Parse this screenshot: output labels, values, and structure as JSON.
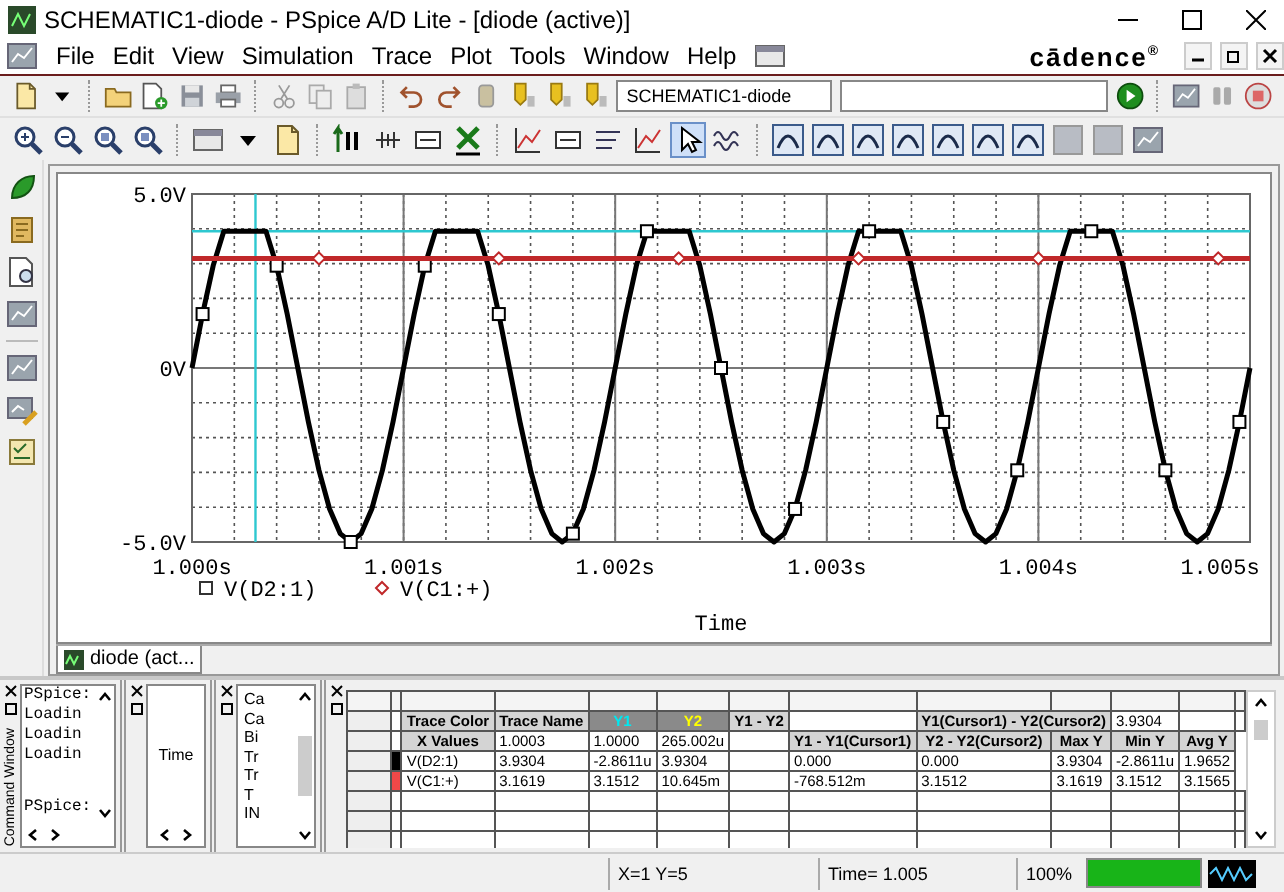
{
  "window": {
    "title": "SCHEMATIC1-diode - PSpice A/D Lite - [diode (active)]"
  },
  "menu": [
    "File",
    "Edit",
    "View",
    "Simulation",
    "Trace",
    "Plot",
    "Tools",
    "Window",
    "Help"
  ],
  "logo": "cādence$^{®}$",
  "toolbar": {
    "profile": "SCHEMATIC1-diode",
    "pointer_tool": {
      "selected": true
    }
  },
  "plot": {
    "tab": "diode (act...",
    "chart_data": {
      "type": "line",
      "xlabel": "Time",
      "xlim": [
        1.0,
        1.005
      ],
      "ylim": [
        -5,
        5
      ],
      "xticks": [
        {
          "value": 1.0,
          "label": "1.000s"
        },
        {
          "value": 1.001,
          "label": "1.001s"
        },
        {
          "value": 1.002,
          "label": "1.002s"
        },
        {
          "value": 1.003,
          "label": "1.003s"
        },
        {
          "value": 1.004,
          "label": "1.004s"
        },
        {
          "value": 1.005,
          "label": "1.005s"
        }
      ],
      "yticks": [
        {
          "value": 5,
          "label": "5.0V"
        },
        {
          "value": 0,
          "label": "0V"
        },
        {
          "value": -5,
          "label": "-5.0V"
        }
      ],
      "x": [
        1.0,
        1.00005,
        1.0001,
        1.00015,
        1.0002,
        1.00025,
        1.0003,
        1.00035,
        1.0004,
        1.00045,
        1.0005,
        1.00055,
        1.0006,
        1.00065,
        1.0007,
        1.00075,
        1.0008,
        1.00085,
        1.0009,
        1.00095,
        1.001,
        1.00105,
        1.0011,
        1.00115,
        1.0012,
        1.00125,
        1.0013,
        1.00135,
        1.0014,
        1.00145,
        1.0015,
        1.00155,
        1.0016,
        1.00165,
        1.0017,
        1.00175,
        1.0018,
        1.00185,
        1.0019,
        1.00195,
        1.002,
        1.00205,
        1.0021,
        1.00215,
        1.0022,
        1.00225,
        1.0023,
        1.00235,
        1.0024,
        1.00245,
        1.0025,
        1.00255,
        1.0026,
        1.00265,
        1.0027,
        1.00275,
        1.0028,
        1.00285,
        1.0029,
        1.00295,
        1.003,
        1.00305,
        1.0031,
        1.00315,
        1.0032,
        1.00325,
        1.0033,
        1.00335,
        1.0034,
        1.00345,
        1.0035,
        1.00355,
        1.0036,
        1.00365,
        1.0037,
        1.00375,
        1.0038,
        1.00385,
        1.0039,
        1.00395,
        1.004,
        1.00405,
        1.0041,
        1.00415,
        1.0042,
        1.00425,
        1.0043,
        1.00435,
        1.0044,
        1.00445,
        1.0045,
        1.00455,
        1.0046,
        1.00465,
        1.0047,
        1.00475,
        1.0048,
        1.00485,
        1.0049,
        1.00495,
        1.005
      ],
      "series": [
        {
          "name": "V(D2:1)",
          "color": "#000000",
          "values": [
            0,
            1.55,
            2.94,
            3.93,
            3.93,
            3.93,
            3.93,
            3.93,
            2.94,
            1.55,
            0,
            -1.55,
            -2.94,
            -4.05,
            -4.76,
            -5,
            -4.76,
            -4.05,
            -2.94,
            -1.55,
            0,
            1.55,
            2.94,
            3.93,
            3.93,
            3.93,
            3.93,
            3.93,
            2.94,
            1.55,
            0,
            -1.55,
            -2.94,
            -4.05,
            -4.76,
            -5,
            -4.76,
            -4.05,
            -2.94,
            -1.55,
            0,
            1.55,
            2.94,
            3.93,
            3.93,
            3.93,
            3.93,
            3.93,
            2.94,
            1.55,
            0,
            -1.55,
            -2.94,
            -4.05,
            -4.76,
            -5,
            -4.76,
            -4.05,
            -2.94,
            -1.55,
            0,
            1.55,
            2.94,
            3.93,
            3.93,
            3.93,
            3.93,
            3.93,
            2.94,
            1.55,
            0,
            -1.55,
            -2.94,
            -4.05,
            -4.76,
            -5,
            -4.76,
            -4.05,
            -2.94,
            -1.55,
            0,
            1.55,
            2.94,
            3.93,
            3.93,
            3.93,
            3.93,
            3.93,
            2.94,
            1.55,
            0,
            -1.55,
            -2.94,
            -4.05,
            -4.76,
            -5,
            -4.76,
            -4.05,
            -2.94,
            -1.55,
            0
          ]
        },
        {
          "name": "V(C1:+)",
          "color": "#c0282a",
          "values": [
            3.15,
            3.15,
            3.15,
            3.15,
            3.15,
            3.15,
            3.15,
            3.15,
            3.15,
            3.15,
            3.15,
            3.15,
            3.15,
            3.15,
            3.15,
            3.15,
            3.15,
            3.15,
            3.15,
            3.15,
            3.15,
            3.15,
            3.15,
            3.15,
            3.15,
            3.15,
            3.15,
            3.15,
            3.15,
            3.15,
            3.15,
            3.15,
            3.15,
            3.15,
            3.15,
            3.15,
            3.15,
            3.15,
            3.15,
            3.15,
            3.15,
            3.15,
            3.15,
            3.15,
            3.15,
            3.15,
            3.15,
            3.15,
            3.15,
            3.15,
            3.15,
            3.15,
            3.15,
            3.15,
            3.15,
            3.15,
            3.15,
            3.15,
            3.15,
            3.15,
            3.15,
            3.15,
            3.15,
            3.15,
            3.15,
            3.15,
            3.15,
            3.15,
            3.15,
            3.15,
            3.15,
            3.15,
            3.15,
            3.15,
            3.15,
            3.15,
            3.15,
            3.15,
            3.15,
            3.15,
            3.15,
            3.15,
            3.15,
            3.15,
            3.15,
            3.15,
            3.15,
            3.15,
            3.15,
            3.15,
            3.15,
            3.15,
            3.15,
            3.15,
            3.15,
            3.15,
            3.15,
            3.15,
            3.15,
            3.15,
            3.15
          ]
        }
      ],
      "grid": true,
      "ref_lines": [
        {
          "axis": "x",
          "value": 1.0003,
          "color": "#2ec8d0"
        },
        {
          "axis": "y",
          "value": 3.9304,
          "color": "#2ec8d0"
        }
      ]
    }
  },
  "command_window": {
    "title": "Command Window",
    "lines": [
      {
        "text": "PSpice:",
        "kind": "line"
      },
      {
        "text": "Loadin",
        "kind": "line"
      },
      {
        "text": "Loadin",
        "kind": "line"
      },
      {
        "text": "Loadin",
        "kind": "line"
      },
      {
        "text": "PSpice:",
        "kind": "spaced"
      }
    ]
  },
  "x_axis_panel": {
    "label": "Time"
  },
  "trace_list": {
    "items": [
      "Ca",
      "Ca",
      "Bi",
      "Tr",
      "Tr",
      "T",
      "IN"
    ]
  },
  "cursor_table": {
    "rows": [
      {
        "cells": [
          {
            "kind": "blank"
          },
          {
            "kind": "header",
            "text": "Trace Color"
          },
          {
            "kind": "header",
            "text": "Trace Name"
          },
          {
            "kind": "cursor1_header",
            "text": "Y1"
          },
          {
            "kind": "cursor2_header",
            "text": "Y2"
          },
          {
            "kind": "header",
            "text": "Y1 - Y2"
          },
          {
            "kind": "blank"
          },
          {
            "kind": "wide_header",
            "colspan": 2,
            "text": "Y1(Cursor1) - Y2(Cursor2)"
          },
          {
            "kind": "value",
            "text": "3.9304"
          },
          {
            "kind": "blank"
          },
          {
            "kind": "blank"
          }
        ]
      },
      {
        "cells": [
          {
            "kind": "blank"
          },
          {
            "kind": "header",
            "text": "X Values"
          },
          {
            "kind": "value",
            "text": "1.0003"
          },
          {
            "kind": "value",
            "text": "1.0000"
          },
          {
            "kind": "value",
            "text": "265.002u"
          },
          {
            "kind": "blank"
          },
          {
            "kind": "header",
            "text": "Y1 - Y1(Cursor1)"
          },
          {
            "kind": "header",
            "text": "Y2 - Y2(Cursor2)"
          },
          {
            "kind": "header",
            "text": "Max Y"
          },
          {
            "kind": "header",
            "text": "Min Y"
          },
          {
            "kind": "header",
            "text": "Avg Y"
          }
        ]
      },
      {
        "cells": [
          {
            "kind": "swatch",
            "color": "#000000"
          },
          {
            "kind": "value",
            "text": "V(D2:1)"
          },
          {
            "kind": "value",
            "text": "3.9304"
          },
          {
            "kind": "value",
            "text": "-2.8611u"
          },
          {
            "kind": "value",
            "text": "3.9304"
          },
          {
            "kind": "blank"
          },
          {
            "kind": "value",
            "text": "0.000"
          },
          {
            "kind": "value",
            "text": "0.000"
          },
          {
            "kind": "value",
            "text": "3.9304"
          },
          {
            "kind": "value",
            "text": "-2.8611u"
          },
          {
            "kind": "value",
            "text": "1.9652"
          }
        ]
      },
      {
        "cells": [
          {
            "kind": "swatch",
            "color": "#f04848"
          },
          {
            "kind": "value",
            "text": "V(C1:+)"
          },
          {
            "kind": "value",
            "text": "3.1619"
          },
          {
            "kind": "value",
            "text": "3.1512"
          },
          {
            "kind": "value",
            "text": "10.645m"
          },
          {
            "kind": "blank"
          },
          {
            "kind": "value",
            "text": "-768.512m"
          },
          {
            "kind": "value",
            "text": "3.1512"
          },
          {
            "kind": "value",
            "text": "3.1619"
          },
          {
            "kind": "value",
            "text": "3.1512"
          },
          {
            "kind": "value",
            "text": "3.1565"
          }
        ]
      }
    ]
  },
  "status_bar": {
    "position": "X=1  Y=5",
    "time": "Time= 1.005",
    "percent": "100%",
    "progress": {
      "level": 1
    }
  }
}
